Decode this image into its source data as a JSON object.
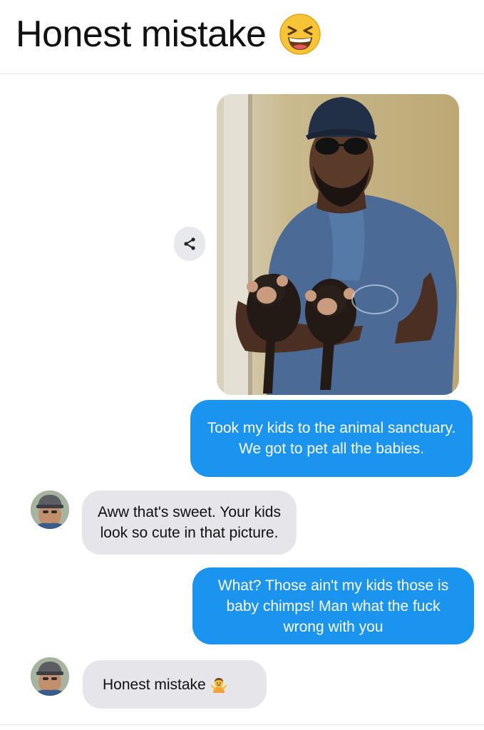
{
  "header": {
    "title": "Honest mistake",
    "title_emoji": "grinning-squinting-face-icon"
  },
  "photo": {
    "alt": "man-holding-two-baby-chimps-photo"
  },
  "share_button": {
    "icon": "share-icon"
  },
  "messages": [
    {
      "direction": "outgoing",
      "text": "Took my kids to the animal sanctuary. We got to pet all the babies."
    },
    {
      "direction": "incoming",
      "text": "Aww that's sweet. Your kids look so cute in that picture."
    },
    {
      "direction": "outgoing",
      "text": "What? Those ain't my kids those is baby chimps! Man what the fuck wrong with you"
    },
    {
      "direction": "incoming",
      "text": "Honest mistake",
      "emoji": "person-shrugging-icon"
    }
  ],
  "colors": {
    "outgoing_bubble": "#1b94f0",
    "incoming_bubble": "#e5e5ea",
    "share_button_bg": "#e8e9ed"
  }
}
